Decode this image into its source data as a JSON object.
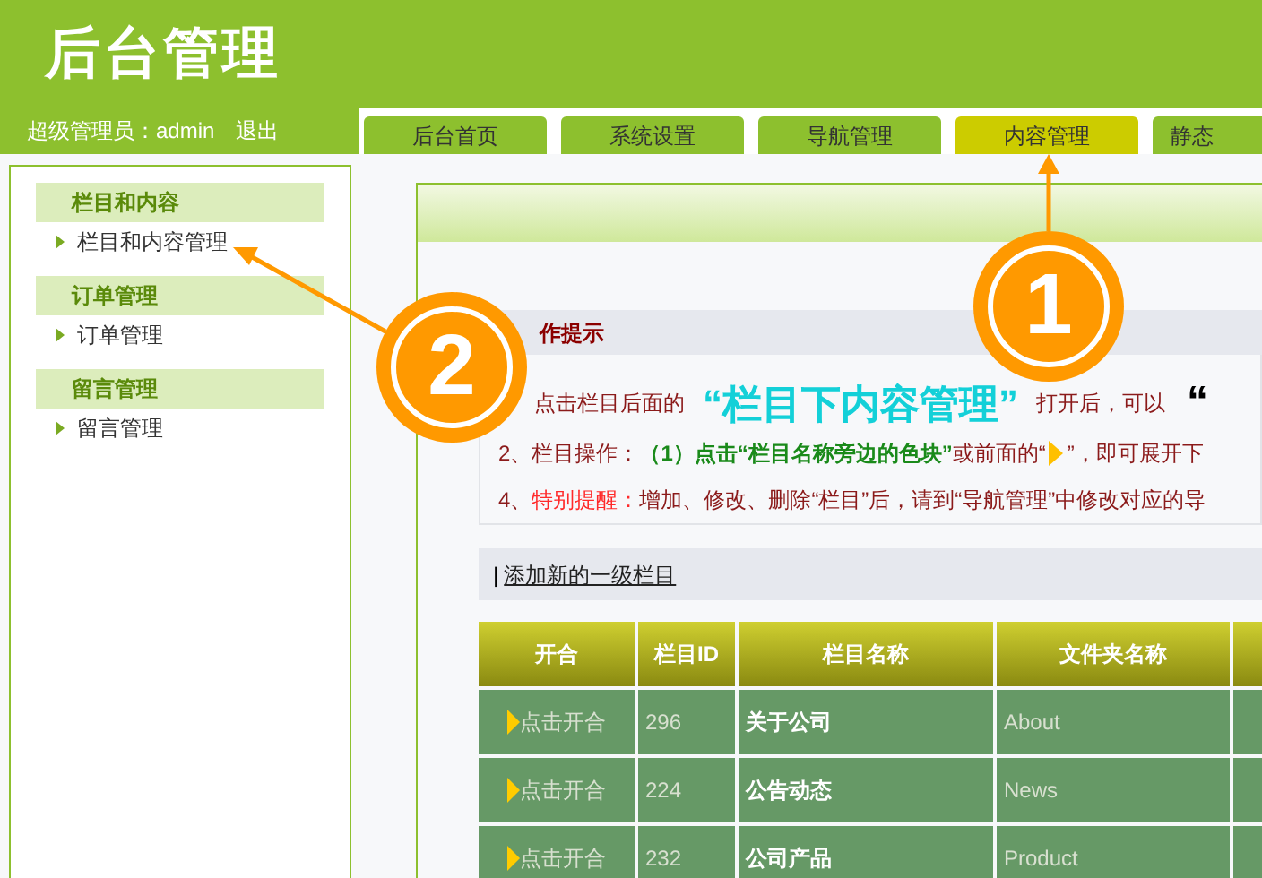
{
  "header": {
    "title": "后台管理"
  },
  "user_bar": {
    "user": "超级管理员：admin",
    "logout": "退出"
  },
  "tabs": [
    {
      "label": "后台首页",
      "selected": false
    },
    {
      "label": "系统设置",
      "selected": false
    },
    {
      "label": "导航管理",
      "selected": false
    },
    {
      "label": "内容管理",
      "selected": true
    },
    {
      "label": "静态",
      "selected": false
    }
  ],
  "sidebar": [
    {
      "heading": "栏目和内容",
      "items": [
        "栏目和内容管理"
      ]
    },
    {
      "heading": "订单管理",
      "items": [
        "订单管理"
      ]
    },
    {
      "heading": "留言管理",
      "items": [
        "留言管理"
      ]
    }
  ],
  "tips": {
    "heading": "作提示",
    "lines": [
      [
        {
          "kind": "plain",
          "text": "点击栏目后面的"
        },
        {
          "kind": "cyan",
          "text": "“栏目下内容管理”"
        },
        {
          "kind": "plain",
          "text": "打开后，可以"
        },
        {
          "kind": "big",
          "text": "“"
        }
      ],
      [
        {
          "kind": "plain",
          "text": "2、栏目操作："
        },
        {
          "kind": "green",
          "text": "（1）点击“栏目名称旁边的色块”"
        },
        {
          "kind": "plain",
          "text": "或前面的“"
        },
        {
          "kind": "arrow"
        },
        {
          "kind": "plain",
          "text": "”，即可展开下"
        }
      ],
      [
        {
          "kind": "plain",
          "text": "4、"
        },
        {
          "kind": "red",
          "text": "特别提醒："
        },
        {
          "kind": "plain",
          "text": "增加、修改、删除“栏目”后，请到“导航管理”中修改对应的导"
        }
      ]
    ]
  },
  "add_bar": {
    "separator": "|",
    "link": "添加新的一级栏目"
  },
  "table": {
    "columns": [
      "开合",
      "栏目ID",
      "栏目名称",
      "文件夹名称"
    ],
    "rows": [
      {
        "toggle": "点击开合",
        "id": "296",
        "name": "关于公司",
        "folder": "About"
      },
      {
        "toggle": "点击开合",
        "id": "224",
        "name": "公告动态",
        "folder": "News"
      },
      {
        "toggle": "点击开合",
        "id": "232",
        "name": "公司产品",
        "folder": "Product"
      }
    ]
  },
  "annotations": [
    {
      "number": "1"
    },
    {
      "number": "2"
    }
  ]
}
